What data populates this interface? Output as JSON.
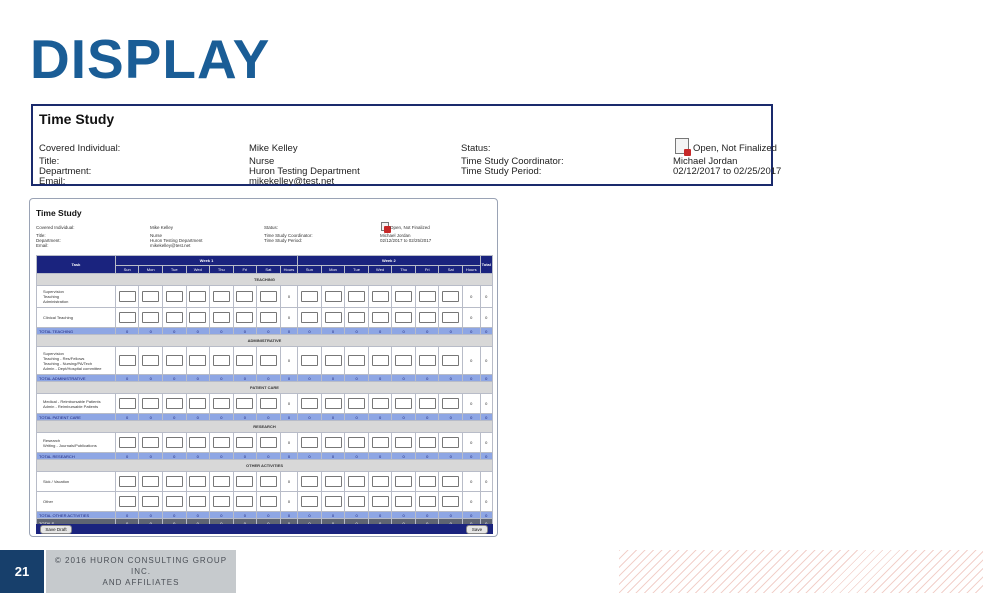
{
  "slide": {
    "title": "DISPLAY",
    "page_number": "21",
    "copyright_line1": "© 2016 HURON CONSULTING GROUP INC.",
    "copyright_line2": "AND AFFILIATES"
  },
  "time_study_header": {
    "title": "Time Study",
    "covered_individual_label": "Covered Individual:",
    "covered_individual_value": "Mike Kelley",
    "title_label": "Title:",
    "title_value": "Nurse",
    "department_label": "Department:",
    "department_value": "Huron Testing Department",
    "email_label": "Email:",
    "email_value": "mikekelley@test.net",
    "status_label": "Status:",
    "status_value": "Open, Not Finalized",
    "coordinator_label": "Time Study Coordinator:",
    "coordinator_value": "Michael Jordan",
    "period_label": "Time Study Period:",
    "period_value": "02/12/2017 to 02/25/2017"
  },
  "form": {
    "title": "Time Study",
    "covered_individual_label": "Covered Individual:",
    "covered_individual_value": "Mike Kelley",
    "title_label": "Title:",
    "title_value": "Nurse",
    "department_label": "Department:",
    "department_value": "Huron Testing Department",
    "email_label": "Email:",
    "email_value": "mikekelley@test.net",
    "status_label": "Status:",
    "status_value": "Open, Not Finalized",
    "coordinator_label": "Time Study Coordinator:",
    "coordinator_value": "Michael Jordan",
    "period_label": "Time Study Period:",
    "period_value": "02/12/2017 to 02/25/2017",
    "task_header": "Task",
    "week1_label": "Week 1",
    "week2_label": "Week 2",
    "days": [
      "Sun",
      "Mon",
      "Tue",
      "Wed",
      "Thu",
      "Fri",
      "Sat"
    ],
    "hours_label": "Hours",
    "total_label": "Total",
    "sections": [
      {
        "category": "TEACHING",
        "rows": [
          {
            "label": "Supervision\nTeaching\nAdministration",
            "w1": "0",
            "w2": "0",
            "total": "0"
          },
          {
            "label": "Clinical Teaching",
            "w1": "0",
            "w2": "0",
            "total": "0"
          }
        ],
        "total_label": "TOTAL TEACHING",
        "totals": [
          "0",
          "0",
          "0",
          "0",
          "0",
          "0",
          "0",
          "0",
          "0",
          "0",
          "0",
          "0",
          "0",
          "0",
          "0",
          "0",
          "0"
        ]
      },
      {
        "category": "ADMINISTRATIVE",
        "rows": [
          {
            "label": "Supervision\nTeaching - Res/Fellows\nTeaching - Nursing/PA/Tech\nAdmin - Dept/Hospital committee",
            "w1": "0",
            "w2": "0",
            "total": "0"
          }
        ],
        "total_label": "TOTAL ADMINISTRATIVE",
        "totals": [
          "0",
          "0",
          "0",
          "0",
          "0",
          "0",
          "0",
          "0",
          "0",
          "0",
          "0",
          "0",
          "0",
          "0",
          "0",
          "0",
          "0"
        ]
      },
      {
        "category": "PATIENT CARE",
        "rows": [
          {
            "label": "Medical - Reimbursable Patients\nAdmin - Reimbursable Patients",
            "w1": "0",
            "w2": "0",
            "total": "0"
          }
        ],
        "total_label": "TOTAL PATIENT CARE",
        "totals": [
          "0",
          "0",
          "0",
          "0",
          "0",
          "0",
          "0",
          "0",
          "0",
          "0",
          "0",
          "0",
          "0",
          "0",
          "0",
          "0",
          "0"
        ]
      },
      {
        "category": "RESEARCH",
        "rows": [
          {
            "label": "Research\nWriting - Journals/Publications",
            "w1": "0",
            "w2": "0",
            "total": "0"
          }
        ],
        "total_label": "TOTAL RESEARCH",
        "totals": [
          "0",
          "0",
          "0",
          "0",
          "0",
          "0",
          "0",
          "0",
          "0",
          "0",
          "0",
          "0",
          "0",
          "0",
          "0",
          "0",
          "0"
        ]
      },
      {
        "category": "OTHER ACTIVITIES",
        "rows": [
          {
            "label": "Sick / Vacation",
            "w1": "0",
            "w2": "0",
            "total": "0"
          },
          {
            "label": "Other",
            "w1": "0",
            "w2": "0",
            "total": "0"
          }
        ],
        "total_label": "TOTAL OTHER ACTIVITIES",
        "totals": [
          "0",
          "0",
          "0",
          "0",
          "0",
          "0",
          "0",
          "0",
          "0",
          "0",
          "0",
          "0",
          "0",
          "0",
          "0",
          "0",
          "0"
        ]
      }
    ],
    "grand_total_label": "TOTALS",
    "grand_totals": [
      "0",
      "0",
      "0",
      "0",
      "0",
      "0",
      "0",
      "0",
      "0",
      "0",
      "0",
      "0",
      "0",
      "0",
      "0",
      "0",
      "0"
    ],
    "save_draft_label": "Save Draft",
    "save_label": "Save"
  },
  "colors": {
    "title_blue": "#1a5d96",
    "grid_header_navy": "#1a237e",
    "section_total_blue": "#8ea6e4",
    "grand_total_gray": "#5e6472",
    "page_number_box": "#173f6b",
    "icons": [
      "document-status-icon"
    ]
  }
}
